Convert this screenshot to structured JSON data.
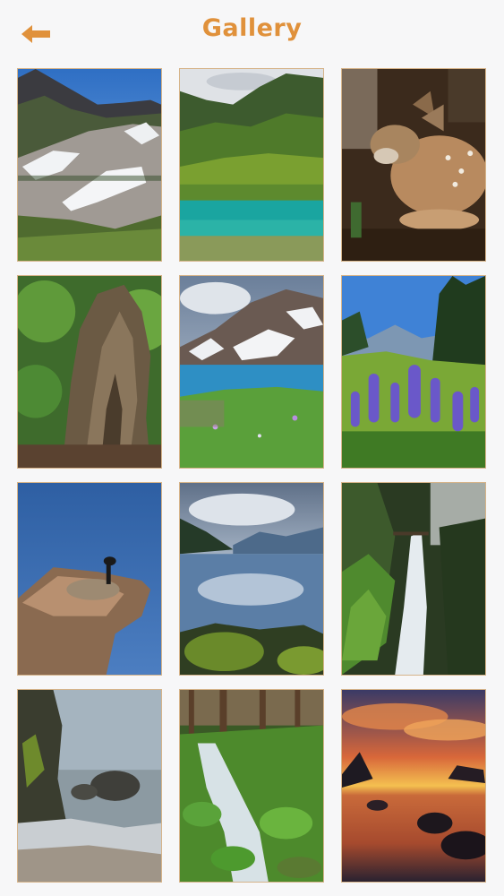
{
  "header": {
    "title": "Gallery",
    "back_icon": "arrow-left-icon",
    "accent_color": "#e0913b"
  },
  "gallery": {
    "photos": [
      {
        "subject": "snowy-mountain-meadow"
      },
      {
        "subject": "turquoise-lake-forest"
      },
      {
        "subject": "fawn"
      },
      {
        "subject": "old-growth-stump"
      },
      {
        "subject": "alpine-lake-wildflowers"
      },
      {
        "subject": "lupine-meadow"
      },
      {
        "subject": "goose-on-driftwood"
      },
      {
        "subject": "lake-reflection"
      },
      {
        "subject": "waterfall-ferns"
      },
      {
        "subject": "coastal-sea-stacks"
      },
      {
        "subject": "mossy-forest-stream"
      },
      {
        "subject": "sunset-beach"
      }
    ]
  }
}
